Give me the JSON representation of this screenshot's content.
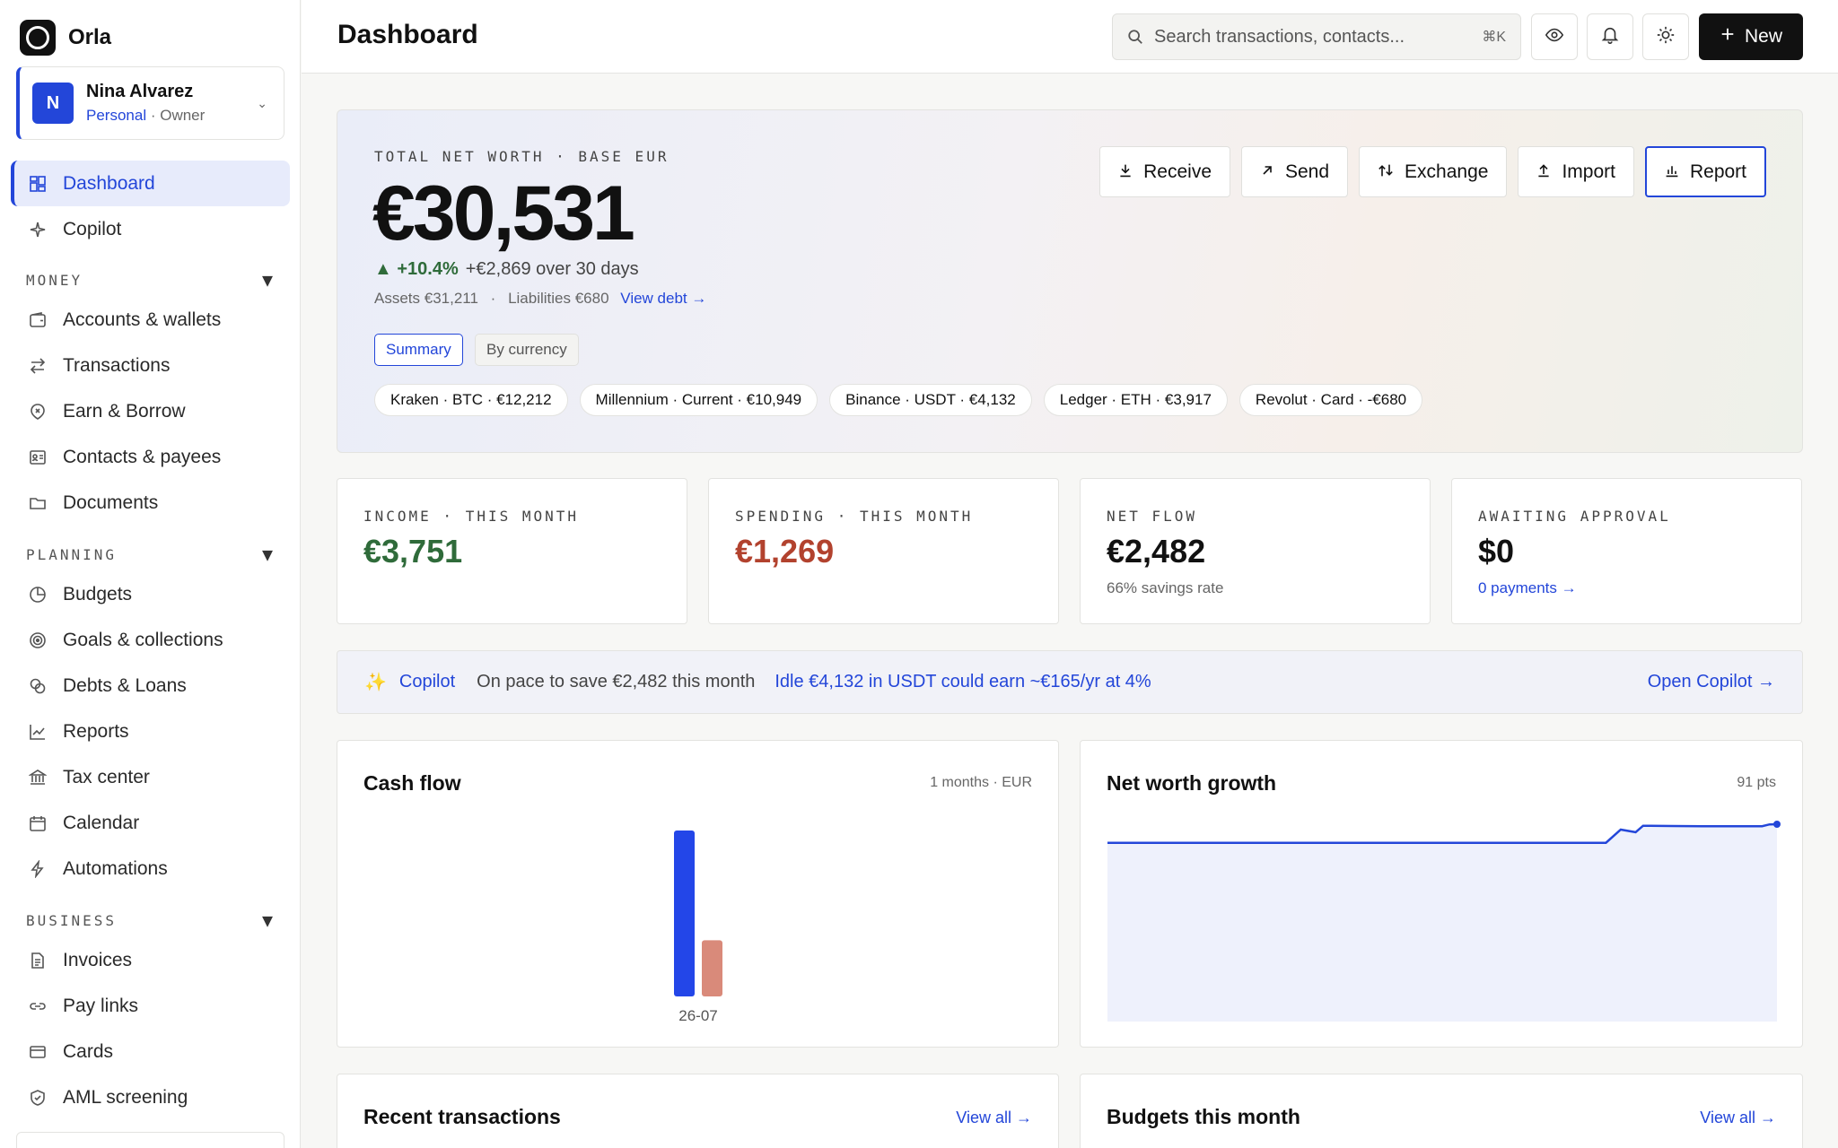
{
  "app": {
    "name": "Orla"
  },
  "account": {
    "initial": "N",
    "name": "Nina Alvarez",
    "type": "Personal",
    "role": "· Owner"
  },
  "nav": {
    "dashboard": "Dashboard",
    "copilot": "Copilot",
    "sections": {
      "money": "MONEY",
      "planning": "PLANNING",
      "business": "BUSINESS"
    },
    "money": [
      "Accounts & wallets",
      "Transactions",
      "Earn & Borrow",
      "Contacts & payees",
      "Documents"
    ],
    "planning": [
      "Budgets",
      "Goals & collections",
      "Debts & Loans",
      "Reports",
      "Tax center",
      "Calendar",
      "Automations"
    ],
    "business": [
      "Invoices",
      "Pay links",
      "Cards",
      "AML screening"
    ]
  },
  "header": {
    "title": "Dashboard",
    "search_placeholder": "Search transactions, contacts...",
    "search_shortcut": "⌘K",
    "new_label": "New"
  },
  "hero": {
    "label": "TOTAL NET WORTH · BASE EUR",
    "value": "€30,531",
    "change_pct": "▲ +10.4%",
    "change_abs": "+€2,869 over 30 days",
    "assets": "Assets €31,211",
    "liabilities": "Liabilities €680",
    "view_debt": "View debt →",
    "tabs": [
      "Summary",
      "By currency"
    ],
    "chips": [
      "Kraken · BTC · €12,212",
      "Millennium · Current · €10,949",
      "Binance · USDT · €4,132",
      "Ledger · ETH · €3,917",
      "Revolut · Card · -€680"
    ],
    "actions": [
      "Receive",
      "Send",
      "Exchange",
      "Import",
      "Report"
    ]
  },
  "stats": [
    {
      "label": "INCOME · THIS MONTH",
      "value": "€3,751",
      "color": "#2f6b3a",
      "sub": ""
    },
    {
      "label": "SPENDING · THIS MONTH",
      "value": "€1,269",
      "color": "#b2422e",
      "sub": ""
    },
    {
      "label": "NET FLOW",
      "value": "€2,482",
      "color": "#111111",
      "sub": "66% savings rate"
    },
    {
      "label": "AWAITING APPROVAL",
      "value": "$0",
      "color": "#111111",
      "sub": "0 payments →"
    }
  ],
  "copilot": {
    "name": "Copilot",
    "insight1": "On pace to save €2,482 this month",
    "insight2": "Idle €4,132 in USDT could earn ~€165/yr at 4%",
    "open": "Open Copilot →"
  },
  "cashflow": {
    "title": "Cash flow",
    "meta": "1 months · EUR",
    "colors": {
      "income": "#2346e8",
      "spending": "#d98a7a"
    },
    "chart_data": {
      "type": "bar",
      "categories": [
        "26-07"
      ],
      "series": [
        {
          "values": [
            3751
          ]
        },
        {
          "values": [
            1269
          ]
        }
      ],
      "ylim": [
        0,
        3751
      ]
    }
  },
  "networth": {
    "title": "Net worth growth",
    "meta": "91 pts",
    "color": "#2346d9",
    "chart_data": {
      "type": "area",
      "x": [
        0,
        67,
        69,
        71,
        72,
        73,
        76,
        80,
        85,
        88,
        89,
        90
      ],
      "y": [
        27662,
        27662,
        29700,
        29300,
        30300,
        30300,
        30250,
        30230,
        30220,
        30220,
        30510,
        30531
      ],
      "ylim": [
        0,
        30531
      ]
    }
  },
  "recent": {
    "title": "Recent transactions",
    "link": "View all →"
  },
  "budgets": {
    "title": "Budgets this month",
    "link": "View all →"
  }
}
